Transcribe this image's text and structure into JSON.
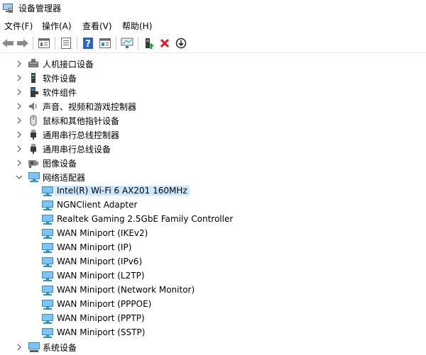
{
  "window": {
    "title": "设备管理器"
  },
  "menu": [
    {
      "label": "文件(F)"
    },
    {
      "label": "操作(A)"
    },
    {
      "label": "查看(V)"
    },
    {
      "label": "帮助(H)"
    }
  ],
  "toolbar_icons": [
    "back-icon",
    "forward-icon",
    "properties-icon",
    "list-icon",
    "help-icon",
    "panel-icon",
    "monitor-icon",
    "update-driver-icon",
    "uninstall-icon",
    "disable-icon"
  ],
  "colors": {
    "selection": "#cce8ff",
    "uninstall_red": "#e81123",
    "net_blue": "#2a8fd8"
  },
  "tree": {
    "categories_top": [
      {
        "label": "人机接口设备",
        "icon": "hid-icon"
      },
      {
        "label": "软件设备",
        "icon": "software-device-icon"
      },
      {
        "label": "软件组件",
        "icon": "software-component-icon"
      },
      {
        "label": "声音、视频和游戏控制器",
        "icon": "speaker-icon"
      },
      {
        "label": "鼠标和其他指针设备",
        "icon": "mouse-icon"
      },
      {
        "label": "通用串行总线控制器",
        "icon": "usb-icon"
      },
      {
        "label": "通用串行总线设备",
        "icon": "usb-icon"
      },
      {
        "label": "图像设备",
        "icon": "camera-icon"
      }
    ],
    "network_category": {
      "label": "网络适配器",
      "icon": "network-adapter-icon",
      "expanded": true
    },
    "network_adapters": [
      {
        "label": "Intel(R) Wi-Fi 6 AX201 160MHz",
        "selected": true
      },
      {
        "label": "NGNClient Adapter"
      },
      {
        "label": "Realtek Gaming 2.5GbE Family Controller"
      },
      {
        "label": "WAN Miniport (IKEv2)"
      },
      {
        "label": "WAN Miniport (IP)"
      },
      {
        "label": "WAN Miniport (IPv6)"
      },
      {
        "label": "WAN Miniport (L2TP)"
      },
      {
        "label": "WAN Miniport (Network Monitor)"
      },
      {
        "label": "WAN Miniport (PPPOE)"
      },
      {
        "label": "WAN Miniport (PPTP)"
      },
      {
        "label": "WAN Miniport (SSTP)"
      }
    ],
    "categories_bottom": [
      {
        "label": "系统设备",
        "icon": "system-device-icon"
      }
    ]
  }
}
